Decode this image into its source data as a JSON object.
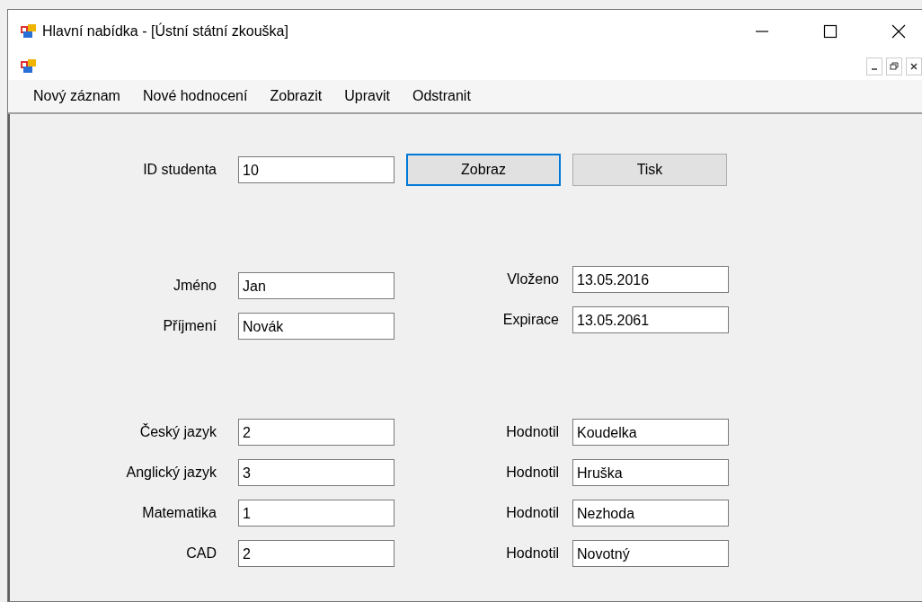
{
  "window": {
    "title": "Hlavní nabídka - [Ústní státní zkouška]"
  },
  "menu": [
    "Nový záznam",
    "Nové hodnocení",
    "Zobrazit",
    "Upravit",
    "Odstranit"
  ],
  "student_id": {
    "label": "ID studenta",
    "value": "10"
  },
  "buttons": [
    {
      "label": "Zobraz",
      "focused": true
    },
    {
      "label": "Tisk",
      "focused": false
    }
  ],
  "person": [
    {
      "label": "Jméno",
      "value": "Jan"
    },
    {
      "label": "Příjmení",
      "value": "Novák"
    }
  ],
  "dates": [
    {
      "label": "Vloženo",
      "value": "13.05.2016"
    },
    {
      "label": "Expirace",
      "value": "13.05.2061"
    }
  ],
  "grades": [
    {
      "subject": "Český jazyk",
      "grade": "2",
      "examiner_label": "Hodnotil",
      "examiner": "Koudelka"
    },
    {
      "subject": "Anglický jazyk",
      "grade": "3",
      "examiner_label": "Hodnotil",
      "examiner": "Hruška"
    },
    {
      "subject": "Matematika",
      "grade": "1",
      "examiner_label": "Hodnotil",
      "examiner": "Nezhoda"
    },
    {
      "subject": "CAD",
      "grade": "2",
      "examiner_label": "Hodnotil",
      "examiner": "Novotný"
    }
  ]
}
